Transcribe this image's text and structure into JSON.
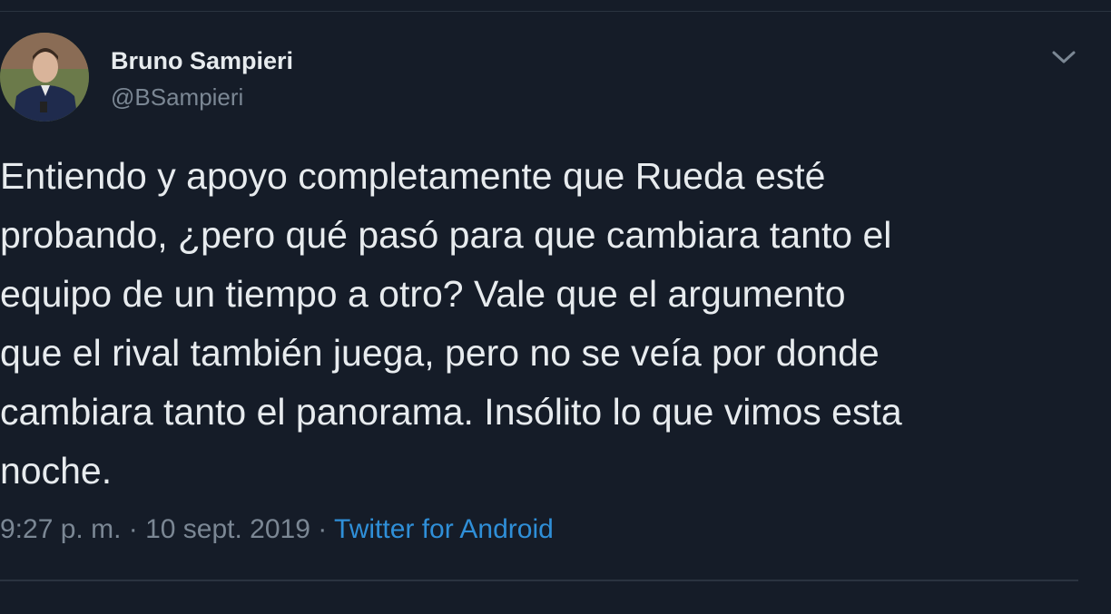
{
  "tweet": {
    "author": {
      "display_name": "Bruno Sampieri",
      "handle": "@BSampieri",
      "avatar_icon": "user-avatar"
    },
    "menu_icon": "chevron-down-icon",
    "text_lines": [
      "Entiendo y apoyo completamente que Rueda esté",
      "probando, ¿pero qué pasó para que cambiara tanto el",
      "equipo de un tiempo a otro? Vale que el argumento",
      "que el rival también juega, pero no se veía por donde",
      "cambiara tanto el panorama. Insólito lo que vimos esta",
      "noche."
    ],
    "time": "9:27 p. m.",
    "separator": " · ",
    "date": "10 sept. 2019",
    "source": "Twitter for Android"
  },
  "colors": {
    "background": "#151c28",
    "text": "#e7ebee",
    "muted": "#7b8794",
    "link": "#2f8fd8"
  }
}
